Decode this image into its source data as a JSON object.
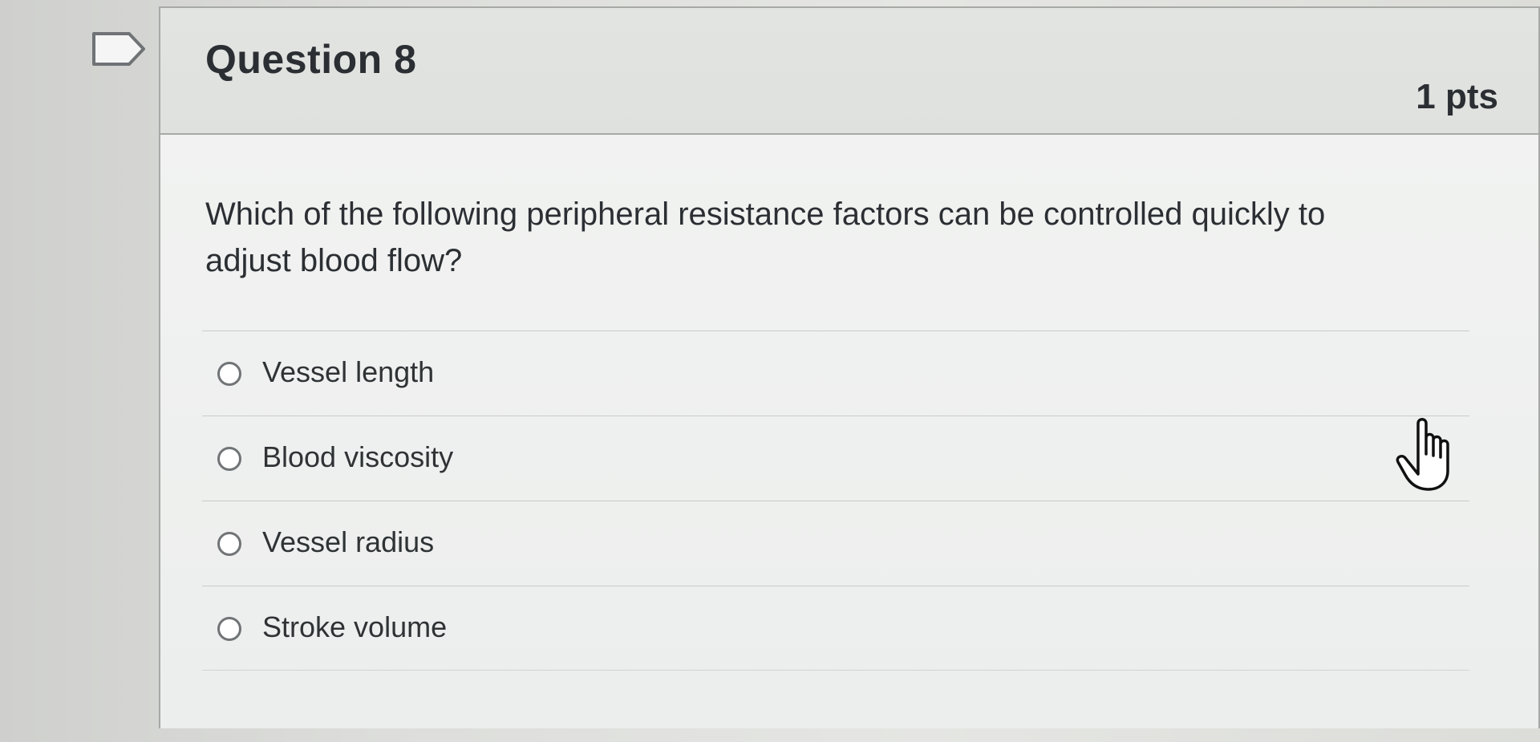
{
  "question": {
    "title": "Question 8",
    "points": "1 pts",
    "prompt": "Which of the following peripheral resistance factors can be controlled quickly to adjust blood flow?"
  },
  "answers": [
    {
      "label": "Vessel length"
    },
    {
      "label": "Blood viscosity"
    },
    {
      "label": "Vessel radius"
    },
    {
      "label": "Stroke volume"
    }
  ],
  "icons": {
    "flag": "flag-icon",
    "cursor": "hand-pointer-icon"
  },
  "colors": {
    "border": "#a7a9a6",
    "text": "#2b2f33",
    "radio_border": "#707476"
  }
}
